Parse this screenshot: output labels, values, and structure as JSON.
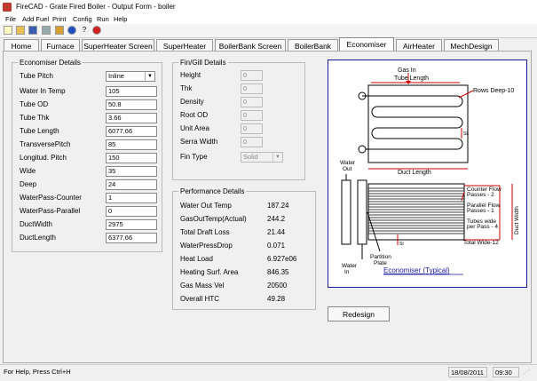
{
  "window": {
    "title": "FireCAD - Grate Fired Boiler - Output Form - boiler"
  },
  "menu": [
    "File",
    "Add Fuel",
    "Print",
    "Config",
    "Run",
    "Help"
  ],
  "tabs": [
    "Home",
    "Furnace",
    "SuperHeater Screen",
    "SuperHeater",
    "BoilerBank Screen",
    "BoilerBank",
    "Economiser",
    "AirHeater",
    "MechDesign"
  ],
  "active_tab": "Economiser",
  "economiser": {
    "title": "Economiser Details",
    "tube_pitch": {
      "label": "Tube Pitch",
      "value": "Inline"
    },
    "fields": [
      {
        "label": "Water In Temp",
        "value": "105"
      },
      {
        "label": "Tube OD",
        "value": "50.8"
      },
      {
        "label": "Tube Thk",
        "value": "3.66"
      },
      {
        "label": "Tube Length",
        "value": "6077.66"
      },
      {
        "label": "TransversePitch",
        "value": "85"
      },
      {
        "label": "Longitud. Pitch",
        "value": "150"
      },
      {
        "label": "Wide",
        "value": "35"
      },
      {
        "label": "Deep",
        "value": "24"
      },
      {
        "label": "WaterPass-Counter",
        "value": "1"
      },
      {
        "label": "WaterPass-Parallel",
        "value": "0"
      },
      {
        "label": "DuctWidth",
        "value": "2975"
      },
      {
        "label": "DuctLength",
        "value": "6377.66"
      }
    ]
  },
  "fin": {
    "title": "Fin/Gill Details",
    "fields": [
      {
        "label": "Height",
        "value": "0"
      },
      {
        "label": "Thk",
        "value": "0"
      },
      {
        "label": "Density",
        "value": "0"
      },
      {
        "label": "Root OD",
        "value": "0"
      },
      {
        "label": "Unit Area",
        "value": "0"
      },
      {
        "label": "Serra Width",
        "value": "0"
      }
    ],
    "fin_type": {
      "label": "Fin Type",
      "value": "Solid"
    }
  },
  "performance": {
    "title": "Performance Details",
    "rows": [
      {
        "label": "Water Out Temp",
        "value": "187.24"
      },
      {
        "label": "GasOutTemp(Actual)",
        "value": "244.2"
      },
      {
        "label": "Total Draft Loss",
        "value": "21.44"
      },
      {
        "label": "WaterPressDrop",
        "value": "0.071"
      },
      {
        "label": "Heat Load",
        "value": "6.927e06"
      },
      {
        "label": "Heating Surf. Area",
        "value": "846.35"
      },
      {
        "label": "Gas Mass Vel",
        "value": "20500"
      },
      {
        "label": "Overall HTC",
        "value": "49.28"
      }
    ]
  },
  "diagram": {
    "gas_in": "Gas In",
    "tube_length": "Tube Length",
    "rows_deep": "Rows Deep-10",
    "duct_length": "Duct Length",
    "water_out": [
      "Water",
      "Out"
    ],
    "counter_flow": [
      "Counter Flow",
      "Passes - 2"
    ],
    "parallel_flow": [
      "Parallel Flow",
      "Passes - 1"
    ],
    "tubes_wide": [
      "Tubes wide",
      "per Pass - 4"
    ],
    "total_wide": "Total Wide-12",
    "duct_width": "Duct Width",
    "partition": [
      "Partition",
      "Plate"
    ],
    "water_in": [
      "Water",
      "In"
    ],
    "caption": "Economiser (Typical)",
    "sl": "SL",
    "st": "St"
  },
  "redesign_label": "Redesign",
  "status": {
    "help": "For Help, Press Ctrl+H",
    "date": "18/08/2011",
    "time": "09:30"
  }
}
